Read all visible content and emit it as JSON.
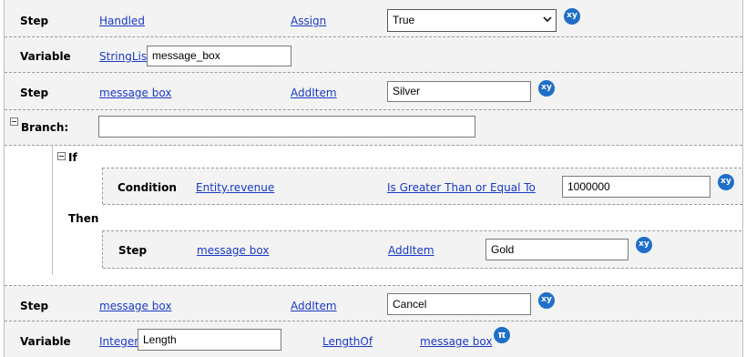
{
  "rows": {
    "step_handled": {
      "type_label": "Step",
      "target": "Handled",
      "action": "Assign",
      "value": "True",
      "badge": "xy"
    },
    "variable_message_box": {
      "type_label": "Variable",
      "var_type": "StringList",
      "name": "message_box"
    },
    "step_add_silver": {
      "type_label": "Step",
      "target": "message box",
      "action": "AddItem",
      "value": "Silver",
      "badge": "xy"
    },
    "branch": {
      "type_label": "Branch:",
      "value": ""
    },
    "if_block": {
      "if_label": "If",
      "condition": {
        "type_label": "Condition",
        "left": "Entity.revenue",
        "operator": "Is Greater Than or Equal To",
        "value": "1000000",
        "badge": "xy"
      },
      "then_label": "Then",
      "then_step": {
        "type_label": "Step",
        "target": "message box",
        "action": "AddItem",
        "value": "Gold",
        "badge": "xy"
      }
    },
    "step_add_cancel": {
      "type_label": "Step",
      "target": "message box",
      "action": "AddItem",
      "value": "Cancel",
      "badge": "xy"
    },
    "variable_length": {
      "type_label": "Variable",
      "var_type": "Integer",
      "name": "Length",
      "function": "LengthOf",
      "argument": "message box",
      "badge": "π"
    }
  },
  "colors": {
    "link": "#1a39c4",
    "row_background": "#f3f3f3",
    "badge": "#1f6fc8"
  }
}
